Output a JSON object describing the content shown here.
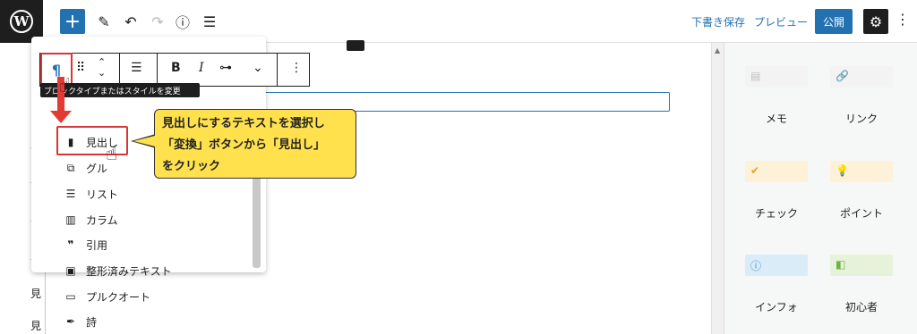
{
  "topbar": {
    "logo": "W",
    "add_icon": "plus-icon",
    "draft_save": "下書き保存",
    "preview": "プレビュー",
    "publish": "公開"
  },
  "toolbar": {
    "paragraph_symbol": "¶",
    "bold": "B",
    "italic": "I",
    "more": "⋮"
  },
  "tooltip": "ブロックタイプまたはスタイルを変更",
  "block_list": [
    {
      "icon": "bookmark-icon",
      "label": "見出し"
    },
    {
      "icon": "group-icon",
      "label": "グル"
    },
    {
      "icon": "list-icon",
      "label": "リスト"
    },
    {
      "icon": "columns-icon",
      "label": "カラム"
    },
    {
      "icon": "quote-icon",
      "label": "引用"
    },
    {
      "icon": "preformatted-icon",
      "label": "整形済みテキスト"
    },
    {
      "icon": "pullquote-icon",
      "label": "プルクオート"
    },
    {
      "icon": "verse-icon",
      "label": "詩"
    }
  ],
  "callout": {
    "line1": "見出しにするテキストを選択し",
    "line2": "「変換」ボタンから「見出し」",
    "line3": "をクリック"
  },
  "sidebar": {
    "patterns": [
      {
        "label": "メモ",
        "color": "#f3f3f3",
        "icon": "memo-icon"
      },
      {
        "label": "リンク",
        "color": "#f3f3f3",
        "icon": "link-icon"
      },
      {
        "label": "チェック",
        "color": "#fdf1d8",
        "icon": "check-icon"
      },
      {
        "label": "ポイント",
        "color": "#fdf1d8",
        "icon": "bulb-icon"
      },
      {
        "label": "インフォ",
        "color": "#d9ecf7",
        "icon": "info-icon"
      },
      {
        "label": "初心者",
        "color": "#e6f2d9",
        "icon": "beginner-icon"
      }
    ]
  },
  "colors": {
    "accent": "#2271b1",
    "highlight_red": "#d63638",
    "callout_yellow": "#ffe14d"
  }
}
